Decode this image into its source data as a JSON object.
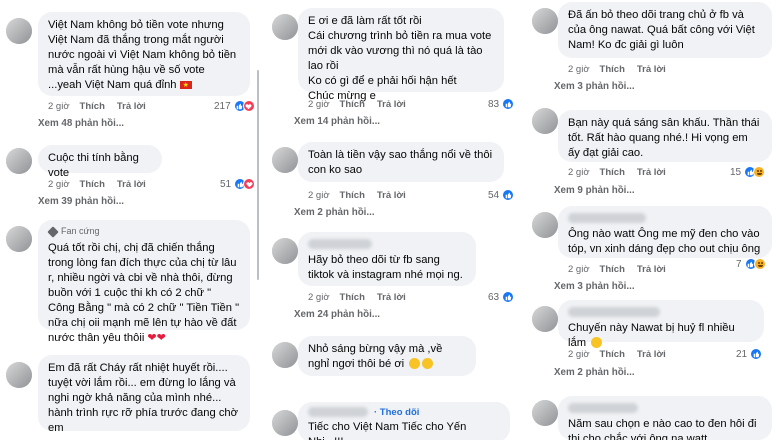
{
  "panel1": {
    "c1": {
      "text": "Việt Nam không bỏ tiền vote nhưng Việt Nam đã thắng trong mắt người nước ngoài vì Việt Nam không bỏ tiền mà vẫn rất hùng hậu về số vote ...yeah Việt Nam quá đỉnh",
      "time": "2 giờ",
      "like": "Thích",
      "reply": "Trả lời",
      "count": "217",
      "replies": "Xem 48 phản hồi..."
    },
    "c2": {
      "text": "Cuộc thi tính bằng vote",
      "time": "2 giờ",
      "like": "Thích",
      "reply": "Trả lời",
      "count": "51",
      "replies": "Xem 39 phản hồi..."
    },
    "c3": {
      "badge": "Fan cứng",
      "text": "Quá tốt rồi chị, chị đã chiến thắng trong lòng fan đích thực của chị từ lâu r, nhiều ngời và cbi về nhà thôi, đừng buồn với 1 cuộc thi kh có 2 chữ \" Công Bằng \" mà có 2 chữ \" Tiền Tiền \" nữa chị oii mạnh mẽ lên tự hào về đất nước thân yêu thôii"
    },
    "c4": {
      "text": "Em đã rất Cháy rất nhiệt huyết rồi.... tuyệt vời lắm rồi... em đừng lo lắng và nghi ngờ khả năng của mình nhé... hành trình rực rỡ phía trước đang chờ em"
    }
  },
  "panel2": {
    "c1": {
      "text": "E ơi e đã làm rất tốt rồi\nCái chương trình bỏ tiền ra mua vote mới dk vào vương thì nó quá là tào lao rồi\nKo có gì để e phải hối hận hết\nChúc mừng e",
      "time": "2 giờ",
      "like": "Thích",
      "reply": "Trả lời",
      "count": "83",
      "replies": "Xem 14 phản hồi..."
    },
    "c2": {
      "text": "Toàn là tiền vậy sao thắng nổi về thôi con ko sao",
      "time": "2 giờ",
      "like": "Thích",
      "reply": "Trả lời",
      "count": "54",
      "replies": "Xem 2 phản hồi..."
    },
    "c3": {
      "text": "Hãy bỏ theo dõi từ fb sang tiktok và instagram nhé mọi ng.",
      "time": "2 giờ",
      "like": "Thích",
      "reply": "Trả lời",
      "count": "63",
      "replies": "Xem 24 phản hồi..."
    },
    "c4": {
      "text": "Nhỏ sáng bừng vậy mà ,về nghỉ ngơi thôi bé ơi"
    },
    "c5": {
      "follow": "· Theo dõi",
      "text": "Tiếc cho Việt Nam Tiếc cho Yến Nhi...!!!"
    }
  },
  "panel3": {
    "c1": {
      "text": "Đã ấn bỏ theo dõi trang chủ ở fb và của ông nawat. Quá bất công với Việt Nam! Ko đc giải gì luôn",
      "time": "2 giờ",
      "like": "Thích",
      "reply": "Trả lời",
      "replies": "Xem 3 phản hồi..."
    },
    "c2": {
      "text": "Bạn này quá sáng sân khấu. Thần thái tốt. Rất hào quang nhé.! Hi vọng em ấy đạt giải cao.",
      "time": "2 giờ",
      "like": "Thích",
      "reply": "Trả lời",
      "count": "15",
      "replies": "Xem 9 phản hồi..."
    },
    "c3": {
      "text": "Ông nào watt Ông me mỹ đen cho vào tóp, vn xinh dáng đẹp cho out chịu ông",
      "time": "2 giờ",
      "like": "Thích",
      "reply": "Trả lời",
      "count": "7",
      "replies": "Xem 3 phản hồi..."
    },
    "c4": {
      "text": "Chuyến này Nawat bị huỷ fl nhiều lắm",
      "time": "2 giờ",
      "like": "Thích",
      "reply": "Trả lời",
      "count": "21",
      "replies": "Xem 2 phản hồi..."
    },
    "c5": {
      "text": "Năm sau chọn e nào cao to đen hôi đi thi cho chắc với ông na watt"
    }
  },
  "colors": {
    "bubble": "#f0f2f5",
    "meta": "#65676b",
    "like": "#1877f2",
    "love": "#f33e58",
    "haha": "#f7b125",
    "link": "#216fdb"
  },
  "icons": [
    "like-reaction-icon",
    "love-reaction-icon",
    "haha-reaction-icon",
    "fan-badge-icon",
    "vietnam-flag-icon",
    "heart-emoji-icon",
    "smile-emoji-icon"
  ]
}
